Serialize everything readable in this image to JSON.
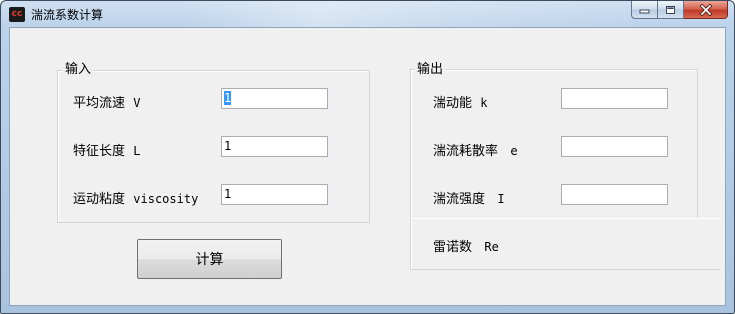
{
  "window": {
    "title": "湍流系数计算",
    "app_icon_text": "cc"
  },
  "input_group": {
    "label": "输入",
    "fields": [
      {
        "label": "平均流速",
        "symbol": "V",
        "value": "1"
      },
      {
        "label": "特征长度",
        "symbol": "L",
        "value": "1"
      },
      {
        "label": "运动粘度",
        "symbol": "viscosity",
        "value": "1"
      }
    ]
  },
  "output_group": {
    "label": "输出",
    "fields": [
      {
        "label": "湍动能",
        "symbol": "k",
        "value": ""
      },
      {
        "label": "湍流耗散率",
        "symbol": "e",
        "value": ""
      },
      {
        "label": "湍流强度",
        "symbol": "I",
        "value": ""
      },
      {
        "label": "雷诺数",
        "symbol": "Re"
      }
    ]
  },
  "calc_button": {
    "label": "计算"
  },
  "icons": {
    "minimize": "minimize-icon",
    "maximize": "maximize-icon",
    "close": "close-icon"
  }
}
